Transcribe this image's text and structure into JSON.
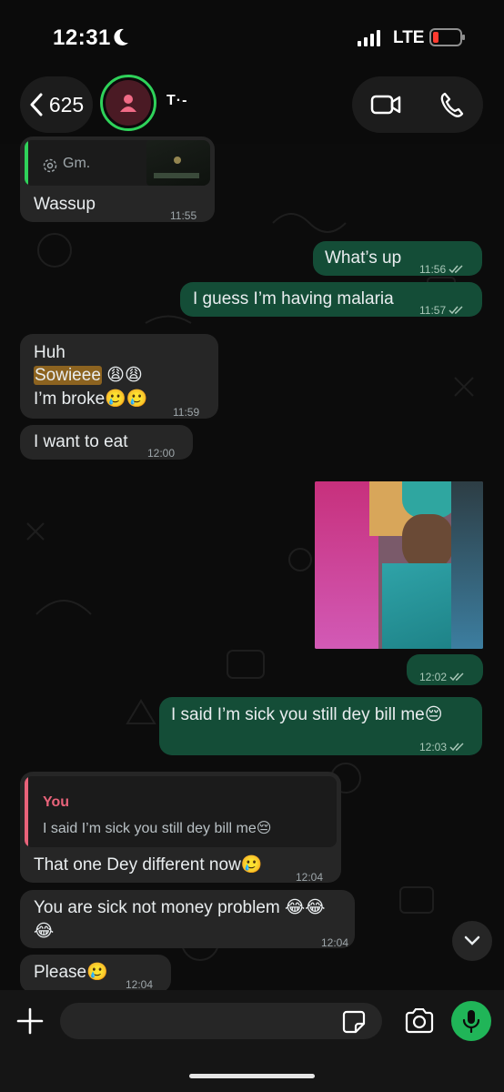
{
  "status": {
    "time": "12:31",
    "network": "LTE"
  },
  "header": {
    "back_count": "625",
    "contact_name": "T·-"
  },
  "messages": [
    {
      "id": "m1",
      "quote_text": "Gm.",
      "text": "Wassup",
      "time": "11:55"
    },
    {
      "id": "m2",
      "text": "What’s up",
      "time": "11:56"
    },
    {
      "id": "m3",
      "text": "I guess I’m having malaria",
      "time": "11:57"
    },
    {
      "id": "m4",
      "line1": "Huh",
      "line2": "Sowieee",
      "line2_emoji": "😩😩",
      "line3": "I’m broke🥲🥲",
      "time": "11:59"
    },
    {
      "id": "m5",
      "text": "I want to eat",
      "time": "12:00"
    },
    {
      "id": "m6",
      "time": "12:02"
    },
    {
      "id": "m7",
      "text": "I said I’m sick you still dey bill me😔",
      "time": "12:03"
    },
    {
      "id": "m8",
      "quote_author": "You",
      "quote_text": "I said I’m sick you still dey bill me😔",
      "text": "That one Dey different now🥲",
      "time": "12:04"
    },
    {
      "id": "m9",
      "line1": "You are sick not money problem 😂😂",
      "line2": "😂",
      "time": "12:04"
    },
    {
      "id": "m10",
      "text": "Please🥲",
      "time": "12:04"
    }
  ],
  "composer": {
    "placeholder": ""
  },
  "icons": [
    "moon-icon",
    "signal-icon",
    "battery-icon",
    "chevron-left-icon",
    "person-icon",
    "video-icon",
    "phone-icon",
    "double-check-icon",
    "chevron-down-icon",
    "plus-icon",
    "sticker-icon",
    "camera-icon",
    "microphone-icon"
  ],
  "colors": {
    "incoming_bubble": "#262626",
    "outgoing_bubble": "#144d37",
    "accent": "#20b558",
    "quote_bar_you": "#e8637a",
    "quote_bar_other": "#2fd25a",
    "highlight": "#8c6320"
  }
}
